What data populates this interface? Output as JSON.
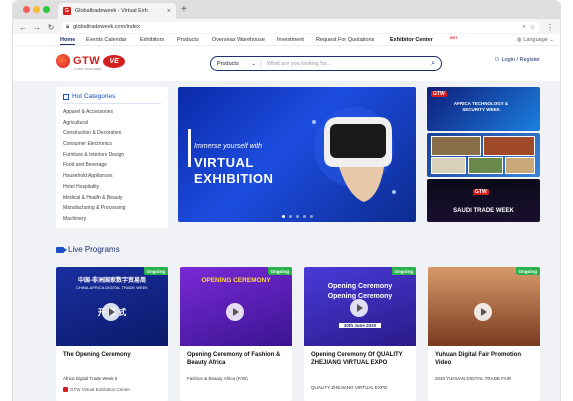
{
  "browser": {
    "tab_title": "Globaltradeweek - Virtual Exh",
    "tab_close": "×",
    "new_tab": "+",
    "url": "globaltradeweek.com/index",
    "favicon_text": "G"
  },
  "nav": {
    "items": [
      "Home",
      "Events Calendar",
      "Exhibitors",
      "Products",
      "Overseas Warehouse",
      "Investment",
      "Request For Quotations",
      "Exhibitor Center"
    ],
    "hot_tag": "HOT",
    "language": "Language"
  },
  "header": {
    "logo_text": "GTW",
    "logo_sub": "GLOBAL TRADE WEEK",
    "ve_badge": "VE",
    "search_category": "Products",
    "search_placeholder": "What are you looking for...",
    "login": "Login / Register"
  },
  "categories": {
    "title": "Hot Categories",
    "items": [
      "Apparel & Accessories",
      "Agricultural",
      "Construction & Decoration",
      "Consumer Electronics",
      "Furniture & Interiors Design",
      "Food and Beverage",
      "Household Appliances",
      "Hotel Hospitality",
      "Medical & Health & Beauty",
      "Manufacturing & Processing",
      "Machinery"
    ]
  },
  "hero": {
    "kicker": "Immerse yourself with",
    "title_line1": "VIRTUAL",
    "title_line2": "EXHIBITION"
  },
  "side_banners": {
    "b1_title": "AFRICA TECHNOLOGY & SECURITY WEEK",
    "b1_logo": "GTW",
    "b3_title": "SAUDI TRADE WEEK",
    "b3_logo": "GTW"
  },
  "live": {
    "title": "Live Programs",
    "cards": [
      {
        "status": "Ongoing",
        "img_line1": "中国-非洲国家数字贸易周",
        "img_line2": "CHINA-AFRICA DIGITAL TRADE WEEK",
        "img_line3": "开 幕 式",
        "title": "The Opening Ceremony",
        "org": "Africa Digital Trade Week II",
        "loc": "GTW Virtual Exhibition Center",
        "bg": "#1a2fa0"
      },
      {
        "status": "Ongoing",
        "img_line1": "OPENING CEREMONY",
        "img_line2": "",
        "img_line3": "",
        "title": "Opening Ceremony of Fashion & Beauty Africa",
        "org": "Fashion & Beauty Africa (FAB)",
        "loc": "",
        "bg": "#6a1fc9"
      },
      {
        "status": "Ongoing",
        "img_line1": "Opening Ceremony",
        "img_line2": "Opening Ceremony",
        "img_line3": "30th June 2020",
        "title": "Opening Ceremony Of QUALITY ZHEJIANG VIRTUAL EXPO",
        "org": "QUALITY ZHEJIANG VIRTUAL EXPO",
        "loc": "",
        "bg": "#3a2ab5"
      },
      {
        "status": "Ongoing",
        "img_line1": "",
        "img_line2": "",
        "img_line3": "",
        "title": "Yuhuan Digital Fair Promotion Video",
        "org": "2020 YUHUAN DIGITAL TRADE FAIR",
        "loc": "",
        "bg": "#b8623a"
      }
    ]
  },
  "colors": {
    "brand_red": "#d21f1f",
    "brand_navy": "#1b2f6e",
    "accent_blue": "#1b4fc9",
    "ongoing_green": "#2bb14c"
  }
}
